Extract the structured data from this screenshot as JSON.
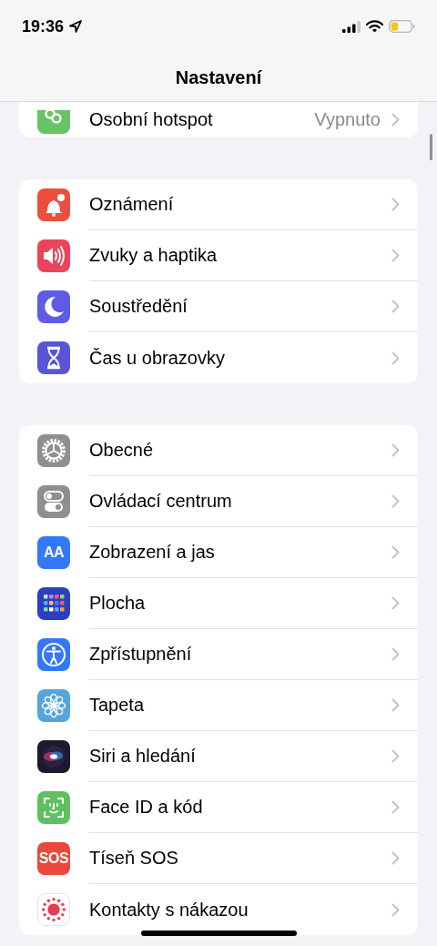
{
  "status_bar": {
    "time": "19:36"
  },
  "nav": {
    "title": "Nastavení"
  },
  "groups": [
    {
      "rows": [
        {
          "kind": "hotspot",
          "color": "#65c466",
          "label": "Osobní hotspot",
          "value": "Vypnuto"
        }
      ]
    },
    {
      "rows": [
        {
          "kind": "bell",
          "color": "#eb4e3d",
          "label": "Oznámení"
        },
        {
          "kind": "speaker",
          "color": "#eb445a",
          "label": "Zvuky a haptika"
        },
        {
          "kind": "moon",
          "color": "#5e5ce6",
          "label": "Soustředění"
        },
        {
          "kind": "hourglass",
          "color": "#5856d6",
          "label": "Čas u obrazovky"
        }
      ]
    },
    {
      "rows": [
        {
          "kind": "gear",
          "color": "#8e8e93",
          "label": "Obecné"
        },
        {
          "kind": "toggles",
          "color": "#8e8e93",
          "label": "Ovládací centrum"
        },
        {
          "kind": "text",
          "color": "#3478f6",
          "icon_label": "AA",
          "label": "Zobrazení a jas"
        },
        {
          "kind": "grid",
          "color": "#2c3fbf",
          "label": "Plocha"
        },
        {
          "kind": "accessibility",
          "color": "#3478f6",
          "label": "Zpřístupnění"
        },
        {
          "kind": "flower",
          "color": "#55a6dd",
          "label": "Tapeta"
        },
        {
          "kind": "siri",
          "color": "#1c1a2e",
          "label": "Siri a hledání"
        },
        {
          "kind": "face",
          "color": "#5ec15f",
          "label": "Face ID a kód"
        },
        {
          "kind": "text",
          "color": "#e9483b",
          "icon_label": "SOS",
          "label": "Tíseň SOS"
        },
        {
          "kind": "dots",
          "color": "#ffffff",
          "label": "Kontakty s nákazou"
        }
      ]
    }
  ]
}
